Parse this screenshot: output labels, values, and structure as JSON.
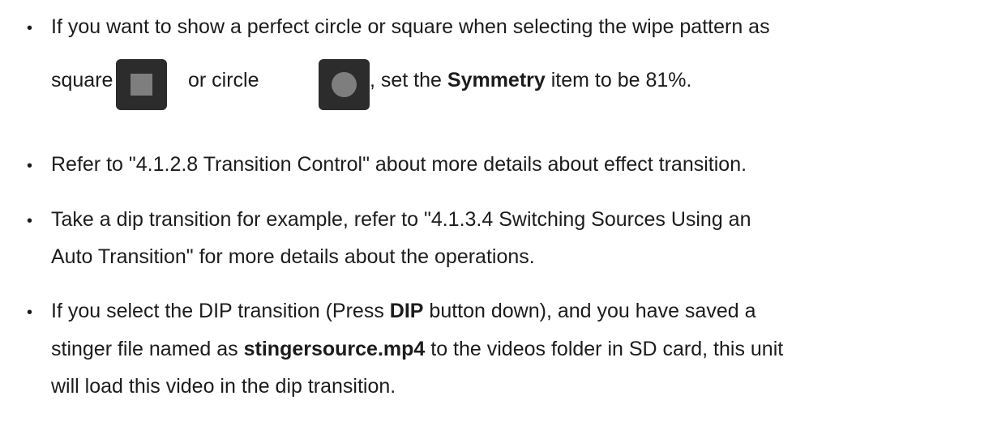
{
  "items": [
    {
      "line1": "If you want to show a perfect circle or square when selecting the wipe pattern as",
      "line2_a": "square",
      "line2_b": "or circle",
      "line2_c": ", set the ",
      "line2_bold": "Symmetry",
      "line2_d": " item to be 81%.",
      "icons": [
        "square-wipe-icon",
        "circle-wipe-icon"
      ]
    },
    {
      "line1": "Refer to \"4.1.2.8 Transition Control\" about more details about effect transition."
    },
    {
      "line1": "Take a dip transition for example, refer to \"4.1.3.4 Switching Sources Using an",
      "line2": "Auto Transition\" for more details about the operations."
    },
    {
      "line1_a": "If you select the DIP transition (Press ",
      "line1_bold": "DIP",
      "line1_b": " button down), and you have saved a",
      "line2_a": "stinger file named as ",
      "line2_bold": "stingersource.mp4",
      "line2_b": " to the videos folder in SD card, this unit",
      "line3": "will load this video in the dip transition."
    }
  ],
  "bullet_char": "•"
}
